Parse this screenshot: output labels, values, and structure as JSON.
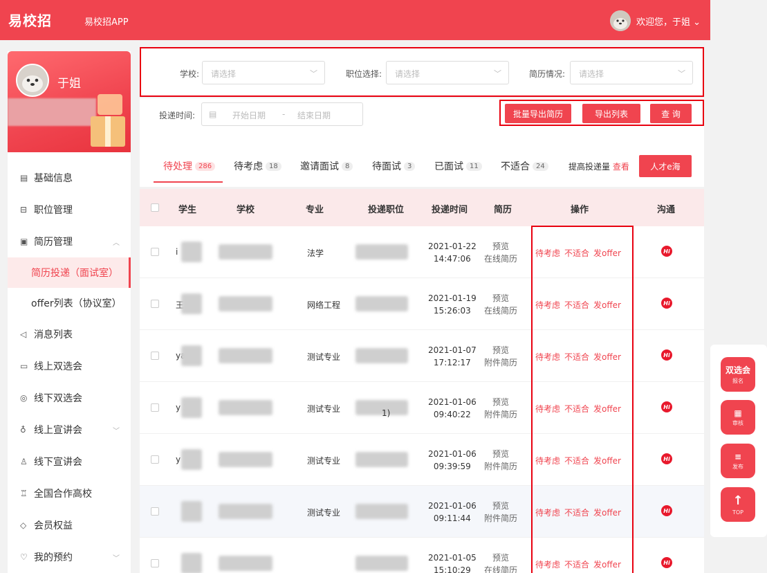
{
  "topbar": {
    "logo": "易校招",
    "app_link": "易校招APP",
    "welcome": "欢迎您，于姐 ⌄"
  },
  "profile": {
    "name": "于姐"
  },
  "menu": {
    "basic_info": "基础信息",
    "job_mgmt": "职位管理",
    "resume_mgmt": "简历管理",
    "resume_delivery": "简历投递（面试室）",
    "offer_list": "offer列表（协议室）",
    "messages": "消息列表",
    "online_fair": "线上双选会",
    "offline_fair": "线下双选会",
    "online_talk": "线上宣讲会",
    "offline_talk": "线下宣讲会",
    "partner_schools": "全国合作高校",
    "member": "会员权益",
    "my_booking": "我的预约"
  },
  "filters": {
    "school_label": "学校:",
    "school_placeholder": "请选择",
    "job_label": "职位选择:",
    "job_placeholder": "请选择",
    "resume_label": "简历情况:",
    "resume_placeholder": "请选择",
    "time_label": "投递时间:",
    "start_date": "开始日期",
    "date_sep": "-",
    "end_date": "结束日期"
  },
  "buttons": {
    "batch_export": "批量导出简历",
    "export_list": "导出列表",
    "query": "查 询"
  },
  "tabs": [
    {
      "label": "待处理",
      "count": "286"
    },
    {
      "label": "待考虑",
      "count": "18"
    },
    {
      "label": "邀请面试",
      "count": "8"
    },
    {
      "label": "待面试",
      "count": "3"
    },
    {
      "label": "已面试",
      "count": "11"
    },
    {
      "label": "不适合",
      "count": "24"
    }
  ],
  "boost": {
    "text": "提高投递量",
    "link": "查看"
  },
  "talent_button": "人才e海",
  "table": {
    "headers": {
      "student": "学生",
      "school": "学校",
      "major": "专业",
      "position": "投递职位",
      "time": "投递时间",
      "resume": "简历",
      "ops": "操作",
      "chat": "沟通"
    },
    "rows": [
      {
        "student": "i",
        "major": "法学",
        "position": "",
        "date": "2021-01-22",
        "time": "14:47:06",
        "r1": "预览",
        "r2": "在线简历"
      },
      {
        "student": "王",
        "major": "网络工程",
        "position": "",
        "date": "2021-01-19",
        "time": "15:26:03",
        "r1": "预览",
        "r2": "在线简历"
      },
      {
        "student": "ya  3",
        "major": "测试专业",
        "position": "",
        "date": "2021-01-07",
        "time": "17:12:17",
        "r1": "预览",
        "r2": "附件简历"
      },
      {
        "student": "y   3",
        "major": "测试专业",
        "position": "1)",
        "date": "2021-01-06",
        "time": "09:40:22",
        "r1": "预览",
        "r2": "附件简历"
      },
      {
        "student": "y",
        "major": "测试专业",
        "position": "",
        "date": "2021-01-06",
        "time": "09:39:59",
        "r1": "预览",
        "r2": "附件简历"
      },
      {
        "student": "",
        "major": "测试专业",
        "position": "",
        "date": "2021-01-06",
        "time": "09:11:44",
        "r1": "预览",
        "r2": "附件简历"
      },
      {
        "student": "",
        "major": "",
        "position": "",
        "date": "2021-01-05",
        "time": "15:10:29",
        "r1": "预览",
        "r2": "在线简历"
      }
    ],
    "op_consider": "待考虑",
    "op_unfit": "不适合",
    "op_offer": "发offer",
    "chat_icon": "Hi"
  },
  "float": {
    "fair": {
      "big": "双选会",
      "small": "报名"
    },
    "review": {
      "small": "审核"
    },
    "publish": {
      "small": "发布"
    },
    "top": {
      "small": "TOP"
    }
  }
}
